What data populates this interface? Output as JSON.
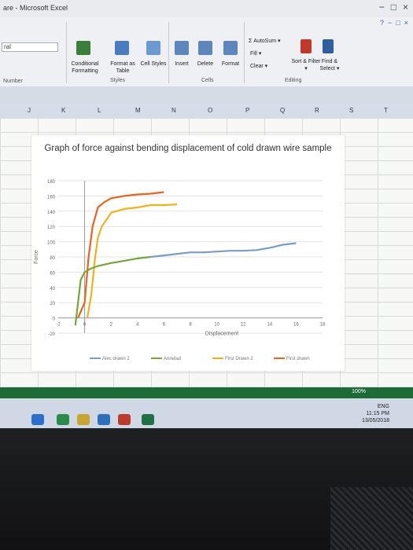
{
  "window": {
    "title": "are - Microsoft Excel",
    "controls": [
      "−",
      "□",
      "×"
    ]
  },
  "ribbon": {
    "name_box": "ral",
    "number_format": "Number",
    "top_right": [
      "?",
      "−",
      "□",
      "×"
    ],
    "styles": {
      "conditional": "Conditional Formatting",
      "format_table": "Format as Table",
      "cell_styles": "Cell Styles",
      "label": "Styles"
    },
    "cells": {
      "insert": "Insert",
      "delete": "Delete",
      "format": "Format",
      "label": "Cells"
    },
    "editing": {
      "autosum": "Σ AutoSum ▾",
      "fill": "Fill ▾",
      "clear": "Clear ▾",
      "sort_filter": "Sort & Filter ▾",
      "find_select": "Find & Select ▾",
      "label": "Editing"
    }
  },
  "columns": [
    "J",
    "K",
    "L",
    "M",
    "N",
    "O",
    "P",
    "Q",
    "R",
    "S",
    "T"
  ],
  "chart_data": {
    "type": "line",
    "title": "Graph of force against bending displacement of cold drawn wire sample",
    "xlabel": "Displacement",
    "ylabel": "Force",
    "xlim": [
      -2,
      18
    ],
    "ylim": [
      -20,
      180
    ],
    "xticks": [
      "-2",
      "0",
      "2",
      "4",
      "6",
      "8",
      "10",
      "12",
      "14",
      "16",
      "18"
    ],
    "yticks": [
      "-20",
      "0",
      "20",
      "40",
      "60",
      "80",
      "100",
      "120",
      "140",
      "160",
      "180"
    ],
    "grid": true,
    "legend_position": "bottom",
    "series": [
      {
        "name": "First drawn",
        "color": "#e8641e",
        "x": [
          -0.5,
          0.0,
          0.3,
          0.6,
          1.0,
          1.5,
          2.0,
          3.0,
          4.0,
          5.0,
          6.0
        ],
        "y": [
          0,
          20,
          80,
          120,
          145,
          152,
          157,
          160,
          162,
          163,
          165
        ]
      },
      {
        "name": "First Drawn 2",
        "color": "#f0b21c",
        "x": [
          0.2,
          0.5,
          0.8,
          1.0,
          1.3,
          1.7,
          2.0,
          3.0,
          4.0,
          5.0,
          6.0,
          7.0
        ],
        "y": [
          0,
          30,
          80,
          105,
          120,
          130,
          138,
          143,
          145,
          148,
          148,
          149
        ]
      },
      {
        "name": "Annelad",
        "color": "#76a63b",
        "x": [
          -0.7,
          -0.5,
          -0.3,
          0.0,
          0.5,
          1.0,
          2.0,
          3.0,
          4.0,
          5.0
        ],
        "y": [
          -10,
          20,
          50,
          60,
          65,
          68,
          72,
          75,
          78,
          80
        ]
      },
      {
        "name": "Alec drawn 2",
        "color": "#7a9cc6",
        "x": [
          5.0,
          6.0,
          7.0,
          8.0,
          9.0,
          10.0,
          11.0,
          12.0,
          13.0,
          14.0,
          15.0,
          16.0
        ],
        "y": [
          80,
          82,
          84,
          86,
          86,
          87,
          88,
          88,
          89,
          92,
          96,
          98
        ]
      }
    ]
  },
  "status": {
    "zoom": "100%"
  },
  "taskbar": {
    "time": "11:15 PM",
    "date": "13/05/2018",
    "lang": "ENG"
  }
}
